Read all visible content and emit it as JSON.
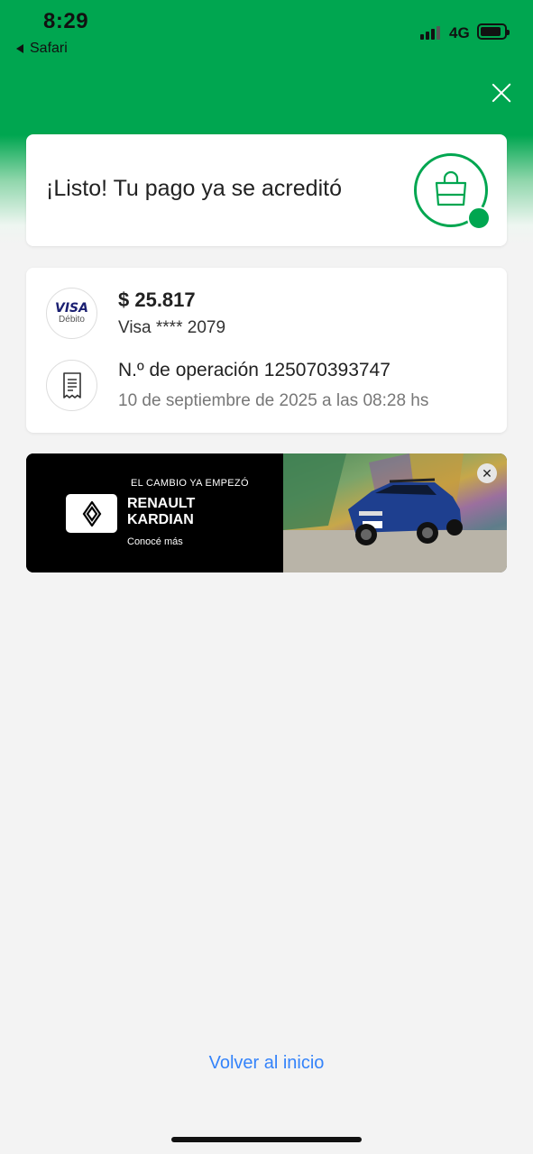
{
  "status_bar": {
    "time": "8:29",
    "back_app": "Safari",
    "network": "4G"
  },
  "success": {
    "title": "¡Listo! Tu pago ya se acreditó",
    "icon": "shopping-bag-icon",
    "accent_color": "#00a650"
  },
  "payment": {
    "card_brand": "VISA",
    "card_type": "Débito",
    "amount": "$ 25.817",
    "card_number": "Visa **** 2079",
    "operation_number": "N.º de operación 125070393747",
    "date": "10 de septiembre de 2025 a las 08:28 hs"
  },
  "ad": {
    "tagline": "EL CAMBIO YA EMPEZÓ",
    "brand_line1": "RENAULT",
    "brand_line2": "KARDIAN",
    "cta": "Conocé más",
    "close_label": "✕"
  },
  "footer": {
    "back_home": "Volver al inicio"
  },
  "colors": {
    "header_green": "#00a650",
    "link_blue": "#3483fa",
    "background": "#f3f3f3"
  }
}
